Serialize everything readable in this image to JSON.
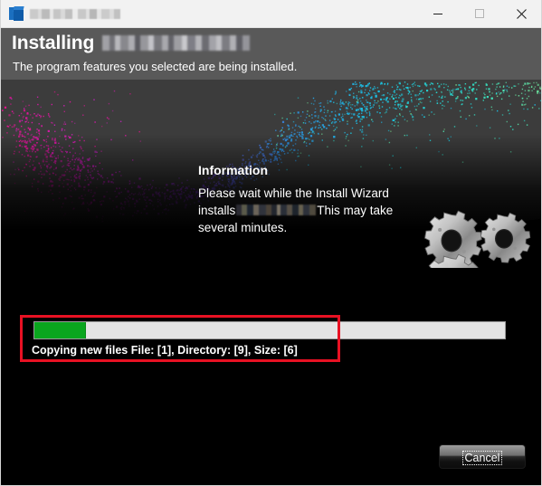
{
  "window": {
    "title_redacted": true,
    "icon": "installer-icon",
    "controls": {
      "minimize": "—",
      "maximize": "□",
      "close": "✕"
    }
  },
  "header": {
    "title_prefix": "Installing",
    "title_product_redacted": true,
    "subtitle": "The program features you selected are being installed."
  },
  "information": {
    "heading": "Information",
    "body_part1": "Please wait while the Install Wizard installs",
    "body_product_redacted": true,
    "body_part2": "This may take several minutes."
  },
  "progress": {
    "percent": 11,
    "fill_color": "#0aa61e",
    "track_color": "#e4e4e4",
    "status_text": "Copying new files File: [1],  Directory: [9],  Size: [6]"
  },
  "annotation": {
    "color": "#e81123",
    "target": "progress-and-status"
  },
  "footer": {
    "cancel_label": "Cancel"
  },
  "banner": {
    "gear_count": 3,
    "particle_colors": [
      "#e8128c",
      "#d020c8",
      "#8a3cd8",
      "#2f8fe0",
      "#19c6e8",
      "#2fe0c8",
      "#8ae88a"
    ]
  }
}
